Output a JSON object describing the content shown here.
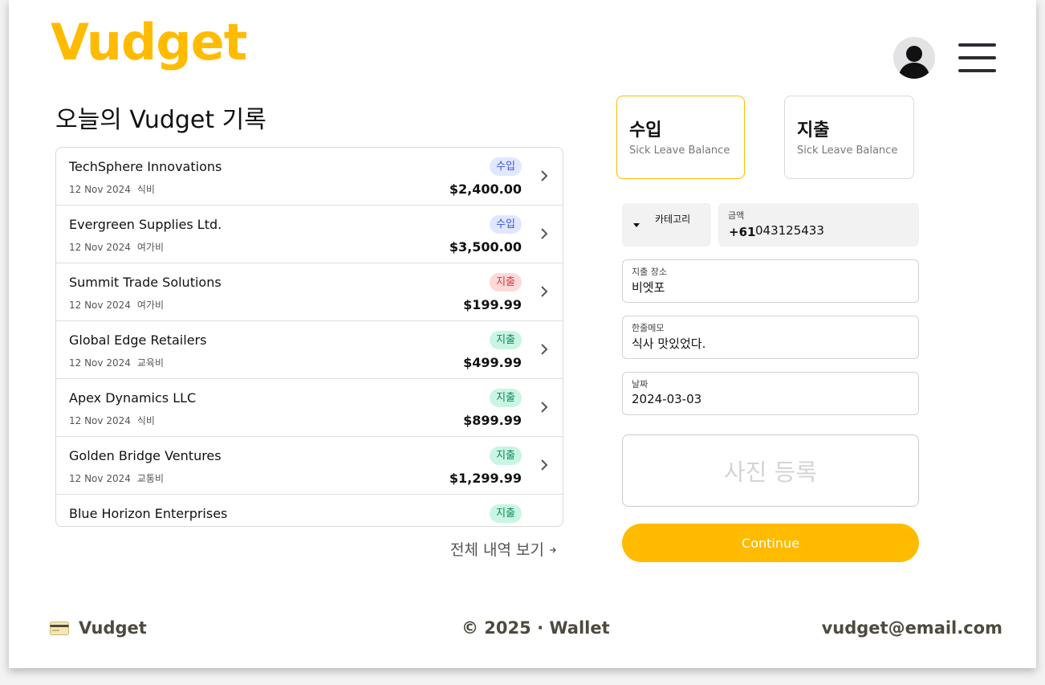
{
  "header": {
    "logo": "Vudget"
  },
  "records_section": {
    "title": "오늘의 Vudget 기록",
    "view_all": "전체 내역 보기",
    "records": [
      {
        "name": "TechSphere Innovations",
        "date": "12 Nov 2024",
        "category": "식비",
        "type": "수입",
        "amount": "$2,400.00"
      },
      {
        "name": "Evergreen Supplies Ltd.",
        "date": "12 Nov 2024",
        "category": "여가비",
        "type": "수입",
        "amount": "$3,500.00"
      },
      {
        "name": "Summit Trade Solutions",
        "date": "12 Nov 2024",
        "category": "여가비",
        "type": "지출",
        "amount": "$199.99"
      },
      {
        "name": "Global Edge Retailers",
        "date": "12 Nov 2024",
        "category": "교육비",
        "type": "지출",
        "amount": "$499.99"
      },
      {
        "name": "Apex Dynamics LLC",
        "date": "12 Nov 2024",
        "category": "식비",
        "type": "지출",
        "amount": "$899.99"
      },
      {
        "name": "Golden Bridge Ventures",
        "date": "12 Nov 2024",
        "category": "교통비",
        "type": "지출",
        "amount": "$1,299.99"
      },
      {
        "name": "Blue Horizon Enterprises",
        "type": "지출"
      }
    ]
  },
  "form": {
    "income_card": {
      "title": "수입",
      "subtitle": "Sick Leave Balance"
    },
    "expense_card": {
      "title": "지출",
      "subtitle": "Sick Leave Balance"
    },
    "category_label": "카테고리",
    "amount": {
      "label": "금액",
      "prefix": "+61",
      "value": "043125433"
    },
    "place": {
      "label": "지출 장소",
      "value": "비엣포"
    },
    "memo": {
      "label": "한줄메모",
      "value": "식사 맛있었다."
    },
    "date": {
      "label": "날짜",
      "value": "2024-03-03"
    },
    "photo_label": "사진 등록",
    "continue_label": "Continue"
  },
  "footer": {
    "brand": "Vudget",
    "copyright": "© 2025 · Wallet",
    "email": "vudget@email.com"
  },
  "colors": {
    "brand": "#ffbb00",
    "income_badge_bg": "#e1e7ff",
    "income_badge_text": "#3856d8",
    "expense_red_bg": "#ffd8d8",
    "expense_green_bg": "#c9f5e3"
  }
}
